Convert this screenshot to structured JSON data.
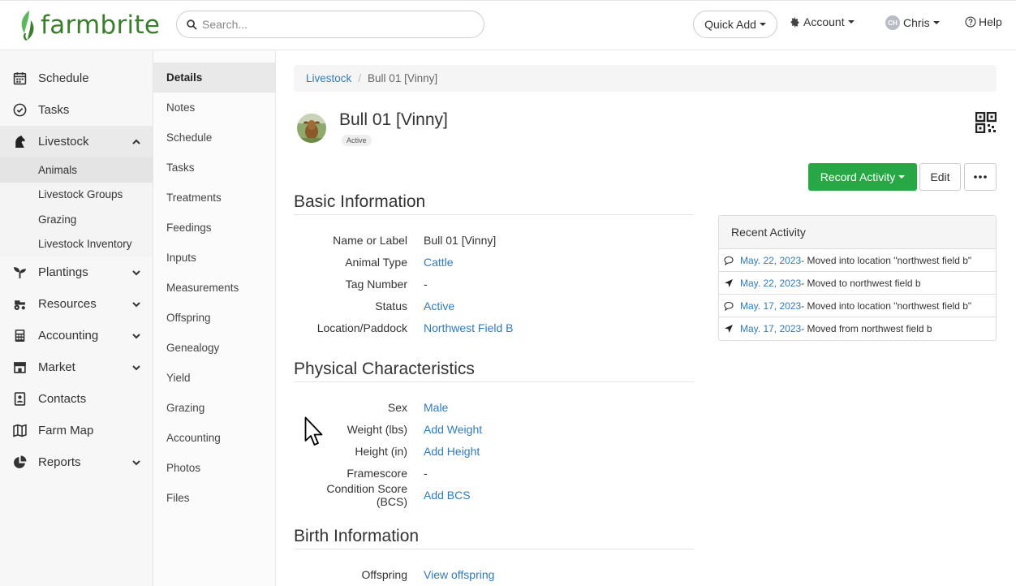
{
  "brand": {
    "name": "farmbrite"
  },
  "search": {
    "placeholder": "Search..."
  },
  "header": {
    "quick_add": "Quick Add",
    "account": "Account",
    "user_initials": "CH",
    "user_name": "Chris",
    "help": "Help"
  },
  "sidebar": {
    "items": [
      {
        "label": "Schedule",
        "icon": "calendar-icon"
      },
      {
        "label": "Tasks",
        "icon": "check-circle-icon"
      },
      {
        "label": "Livestock",
        "icon": "horse-icon"
      },
      {
        "label": "Plantings",
        "icon": "seedling-icon"
      },
      {
        "label": "Resources",
        "icon": "tractor-icon"
      },
      {
        "label": "Accounting",
        "icon": "calculator-icon"
      },
      {
        "label": "Market",
        "icon": "store-icon"
      },
      {
        "label": "Contacts",
        "icon": "address-book-icon"
      },
      {
        "label": "Farm Map",
        "icon": "map-icon"
      },
      {
        "label": "Reports",
        "icon": "pie-chart-icon"
      }
    ],
    "livestock_sub": [
      "Animals",
      "Livestock Groups",
      "Grazing",
      "Livestock Inventory"
    ]
  },
  "subnav": {
    "items": [
      "Details",
      "Notes",
      "Schedule",
      "Tasks",
      "Treatments",
      "Feedings",
      "Inputs",
      "Measurements",
      "Offspring",
      "Genealogy",
      "Yield",
      "Grazing",
      "Accounting",
      "Photos",
      "Files"
    ]
  },
  "breadcrumb": {
    "parent": "Livestock",
    "separator": "/",
    "current": "Bull 01 [Vinny]"
  },
  "animal": {
    "name": "Bull 01 [Vinny]",
    "status": "Active"
  },
  "actions": {
    "record_activity": "Record Activity",
    "edit": "Edit"
  },
  "basic": {
    "title": "Basic Information",
    "fields": [
      {
        "label": "Name or Label",
        "value": "Bull 01 [Vinny]"
      },
      {
        "label": "Animal Type",
        "value": "Cattle"
      },
      {
        "label": "Tag Number",
        "value": "-"
      },
      {
        "label": "Status",
        "value": "Active"
      },
      {
        "label": "Location/Paddock",
        "value": "Northwest Field B"
      }
    ]
  },
  "physical": {
    "title": "Physical Characteristics",
    "fields": [
      {
        "label": "Sex",
        "value": "Male"
      },
      {
        "label": "Weight (lbs)",
        "value": "Add Weight"
      },
      {
        "label": "Height (in)",
        "value": "Add Height"
      },
      {
        "label": "Framescore",
        "value": "-"
      },
      {
        "label": "Condition Score (BCS)",
        "value": "Add BCS"
      }
    ]
  },
  "birth": {
    "title": "Birth Information",
    "fields": [
      {
        "label": "Offspring",
        "value": "View offspring"
      }
    ]
  },
  "activity": {
    "title": "Recent Activity",
    "rows": [
      {
        "icon": "comment-icon",
        "date": "May. 22, 2023",
        "text": " - Moved into location \"northwest field b\""
      },
      {
        "icon": "location-arrow-icon",
        "date": "May. 22, 2023",
        "text": " - Moved to northwest field b"
      },
      {
        "icon": "comment-icon",
        "date": "May. 17, 2023",
        "text": " - Moved into location \"northwest field b\""
      },
      {
        "icon": "location-arrow-icon",
        "date": "May. 17, 2023",
        "text": " - Moved from northwest field b"
      }
    ]
  },
  "colors": {
    "brand_green": "#3a7d2c",
    "button_green": "#28a745",
    "link": "#337ab7"
  }
}
